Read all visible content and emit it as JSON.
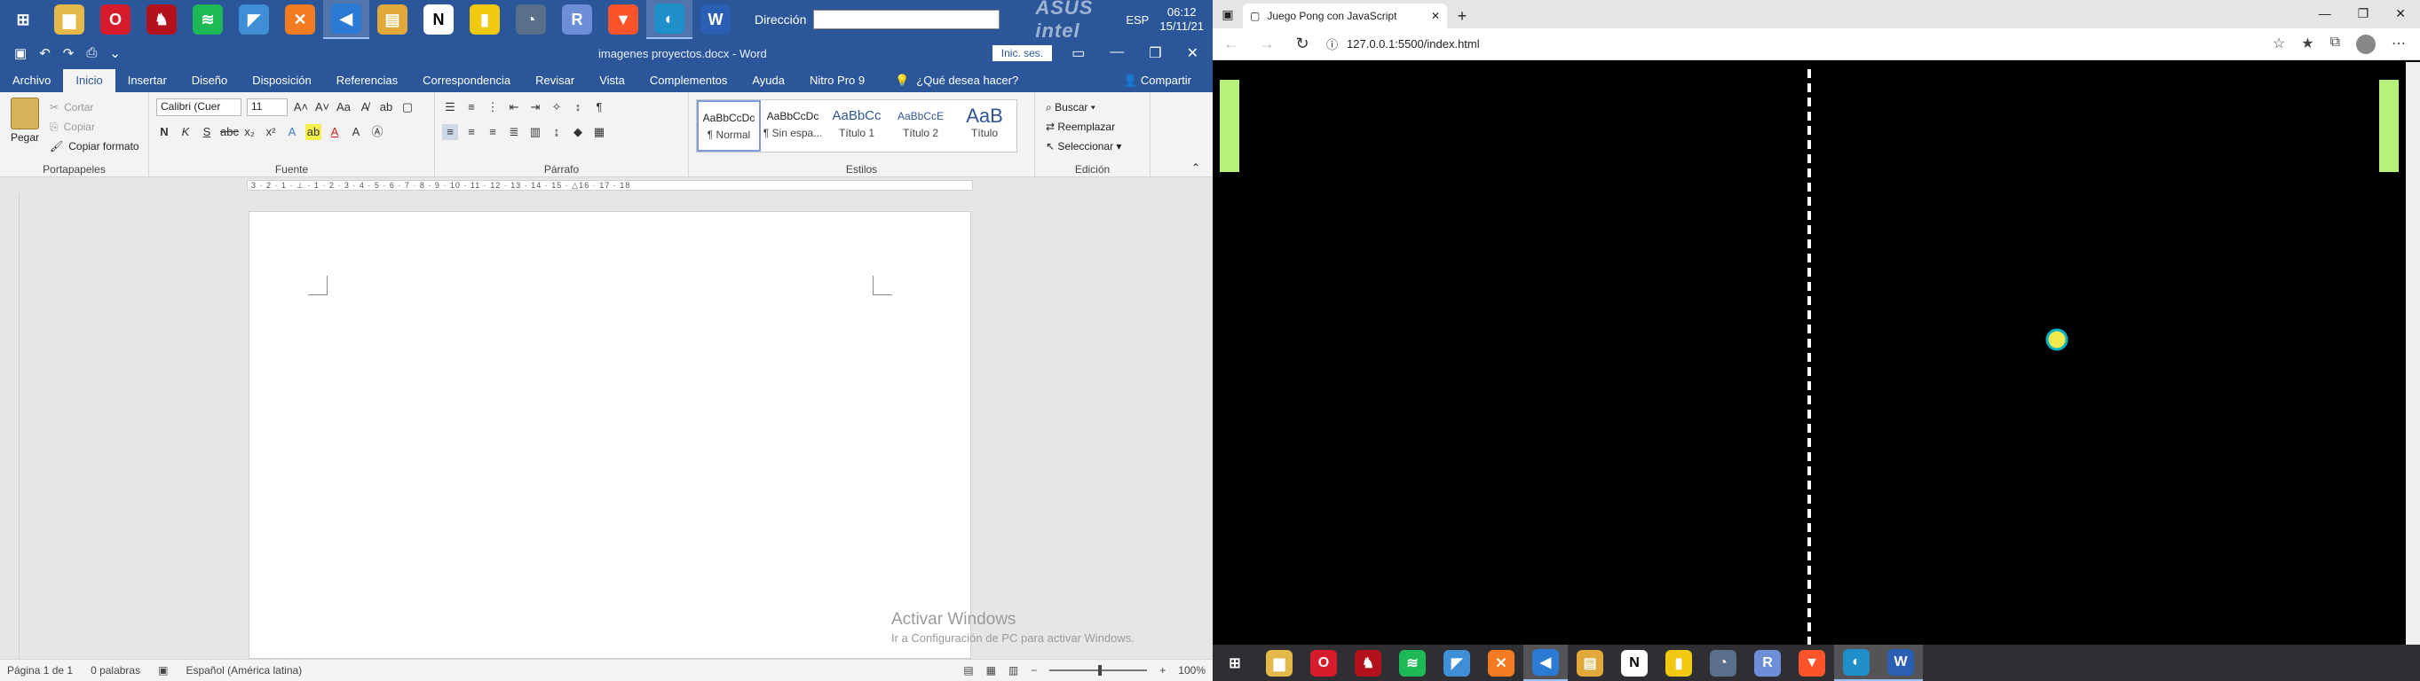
{
  "top_taskbar": {
    "apps": [
      {
        "name": "windows-start",
        "glyph": "⊞",
        "color": "#2b579a"
      },
      {
        "name": "file-explorer",
        "glyph": "▆",
        "color": "#e5b84a"
      },
      {
        "name": "opera-browser",
        "glyph": "O",
        "color": "#d61b2b"
      },
      {
        "name": "game-launcher",
        "glyph": "♞",
        "color": "#b3121c"
      },
      {
        "name": "spotify",
        "glyph": "≋",
        "color": "#1db954"
      },
      {
        "name": "sublime-app",
        "glyph": "◤",
        "color": "#3f8fd6"
      },
      {
        "name": "xampp",
        "glyph": "✕",
        "color": "#f47b20"
      },
      {
        "name": "vscode",
        "glyph": "◀",
        "color": "#2b7ad4"
      },
      {
        "name": "file-manager",
        "glyph": "▤",
        "color": "#e0a93a"
      },
      {
        "name": "notion",
        "glyph": "N",
        "color": "#111111"
      },
      {
        "name": "power-bi",
        "glyph": "▮",
        "color": "#f2c811"
      },
      {
        "name": "vpn-app",
        "glyph": "◔",
        "color": "#5a6f8a"
      },
      {
        "name": "r-language",
        "glyph": "R",
        "color": "#6c8fd8"
      },
      {
        "name": "brave-browser",
        "glyph": "▼",
        "color": "#fb542b"
      },
      {
        "name": "edge-browser",
        "glyph": "◐",
        "color": "#1f8fc9"
      },
      {
        "name": "word",
        "glyph": "W",
        "color": "#2b5fb4"
      }
    ],
    "address_label": "Dirección",
    "address_value": "",
    "brand": "ASUS  intel",
    "language": "ESP",
    "time": "06:12",
    "date": "15/11/21"
  },
  "word": {
    "doc_title": "imagenes proyectos.docx - Word",
    "sign_in": "Inic. ses.",
    "tabs": [
      "Archivo",
      "Inicio",
      "Insertar",
      "Diseño",
      "Disposición",
      "Referencias",
      "Correspondencia",
      "Revisar",
      "Vista",
      "Complementos",
      "Ayuda",
      "Nitro Pro 9"
    ],
    "active_tab": "Inicio",
    "tell_me": "¿Qué desea hacer?",
    "share": "Compartir",
    "clipboard": {
      "paste": "Pegar",
      "cut": "Cortar",
      "copy": "Copiar",
      "format_painter": "Copiar formato",
      "label": "Portapapeles"
    },
    "font": {
      "family": "Calibri (Cuer",
      "size": "11",
      "label": "Fuente"
    },
    "paragraph": {
      "label": "Párrafo"
    },
    "styles": {
      "items": [
        {
          "preview": "AaBbCcDc",
          "name": "¶ Normal"
        },
        {
          "preview": "AaBbCcDc",
          "name": "¶ Sin espa..."
        },
        {
          "preview": "AaBbCc",
          "name": "Título 1"
        },
        {
          "preview": "AaBbCcE",
          "name": "Título 2"
        },
        {
          "preview": "AaB",
          "name": "Título"
        }
      ],
      "label": "Estilos"
    },
    "editing": {
      "find": "Buscar",
      "replace": "Reemplazar",
      "select": "Seleccionar",
      "label": "Edición"
    },
    "ruler_text": "3 · 2 · 1 · ⊥ · 1 · 2 · 3 · 4 · 5 · 6 · 7 · 8 · 9 · 10 · 11 · 12 · 13 · 14 · 15 · △16 · 17 · 18",
    "activate": {
      "title": "Activar Windows",
      "subtitle": "Ir a Configuración de PC para activar Windows."
    },
    "status": {
      "page": "Página 1 de 1",
      "words": "0 palabras",
      "language": "Español (América latina)",
      "zoom": "100%"
    }
  },
  "browser": {
    "tab_title": "Juego Pong con JavaScript",
    "url": "127.0.0.1:5500/index.html",
    "game": {
      "background": "#000000",
      "paddle_color": "#b6f27a",
      "ball_color": "#f2e94e",
      "ball_outline": "#00b3c7",
      "net_color": "#ffffff"
    }
  },
  "bottom_taskbar": {
    "apps": [
      {
        "name": "windows-start",
        "glyph": "⊞",
        "color": "#2f2f33"
      },
      {
        "name": "file-explorer",
        "glyph": "▆",
        "color": "#e5b84a"
      },
      {
        "name": "opera-browser",
        "glyph": "O",
        "color": "#d61b2b"
      },
      {
        "name": "game-launcher",
        "glyph": "♞",
        "color": "#b3121c"
      },
      {
        "name": "spotify",
        "glyph": "≋",
        "color": "#1db954"
      },
      {
        "name": "sublime-app",
        "glyph": "◤",
        "color": "#3f8fd6"
      },
      {
        "name": "xampp",
        "glyph": "✕",
        "color": "#f47b20"
      },
      {
        "name": "vscode",
        "glyph": "◀",
        "color": "#2b7ad4"
      },
      {
        "name": "file-manager",
        "glyph": "▤",
        "color": "#e0a93a"
      },
      {
        "name": "notion",
        "glyph": "N",
        "color": "#ffffff"
      },
      {
        "name": "power-bi",
        "glyph": "▮",
        "color": "#f2c811"
      },
      {
        "name": "vpn-app",
        "glyph": "◔",
        "color": "#5a6f8a"
      },
      {
        "name": "r-language",
        "glyph": "R",
        "color": "#6c8fd8"
      },
      {
        "name": "brave-browser",
        "glyph": "▼",
        "color": "#fb542b"
      },
      {
        "name": "edge-browser",
        "glyph": "◐",
        "color": "#1f8fc9"
      },
      {
        "name": "word",
        "glyph": "W",
        "color": "#2b5fb4"
      }
    ]
  }
}
